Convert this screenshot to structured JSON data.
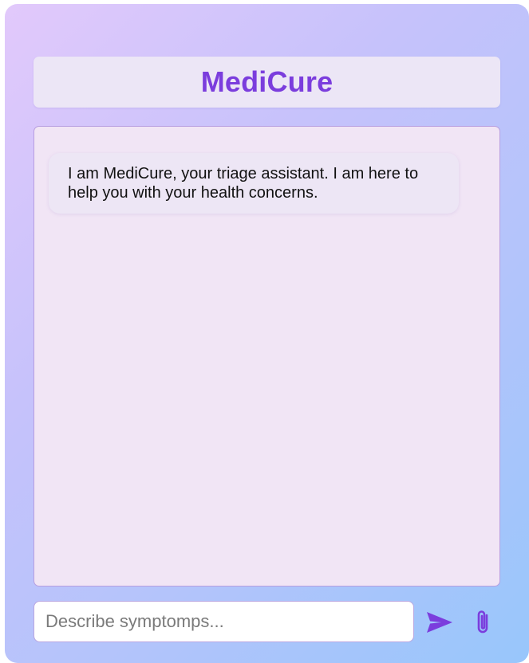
{
  "app": {
    "title": "MediCure"
  },
  "chat": {
    "messages": [
      {
        "role": "assistant",
        "text": "I am MediCure, your triage assistant. I am here to help you with your health concerns."
      }
    ]
  },
  "composer": {
    "value": "",
    "placeholder": "Describe symptomps...",
    "send_icon": "send-icon",
    "attach_icon": "paperclip-icon"
  },
  "colors": {
    "accent": "#7b3ddd",
    "header_bg": "#ece6f6",
    "chat_bg": "#f1e5f5",
    "bubble_bg": "#ede6f5",
    "gradient_start": "#e2c9fb",
    "gradient_end": "#98c6fb"
  }
}
